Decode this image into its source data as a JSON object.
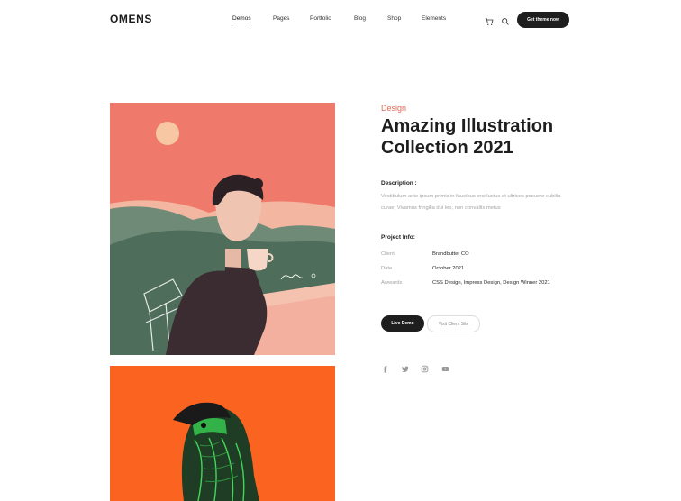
{
  "header": {
    "logo": "OMENS",
    "nav": [
      {
        "label": "Demos",
        "active": true
      },
      {
        "label": "Pages",
        "active": false
      },
      {
        "label": "Portfolio",
        "active": false
      },
      {
        "label": "Blog",
        "active": false
      },
      {
        "label": "Shop",
        "active": false
      },
      {
        "label": "Elements",
        "active": false
      }
    ],
    "icons": [
      "cart-icon",
      "search-icon"
    ],
    "cta_label": "Get theme now"
  },
  "project": {
    "category": "Design",
    "title": "Amazing Illustration Collection 2021",
    "description_heading": "Description :",
    "description": "Vestibulum ante ipsum primis in faucibus orci luctus et ultrices posuere cubilia curae; Vivamus fringilla dui leo, non convallis metus",
    "info_heading": "Project Info:",
    "info": [
      {
        "label": "Client",
        "value": "Brandbutter CO"
      },
      {
        "label": "Date",
        "value": "October 2021"
      },
      {
        "label": "Awwards",
        "value": "CSS Design, Impress Design, Design Winner 2021"
      }
    ],
    "live_button": "Live Demo",
    "visit_button": "Visit Client Site"
  },
  "social": [
    "facebook-icon",
    "twitter-icon",
    "instagram-icon",
    "youtube-icon"
  ],
  "colors": {
    "accent": "#e06a55",
    "dark": "#1e1e1e",
    "muted": "#a3a3a3",
    "art1_sky": "#ef7a6c",
    "art2_bg": "#fb6420"
  }
}
